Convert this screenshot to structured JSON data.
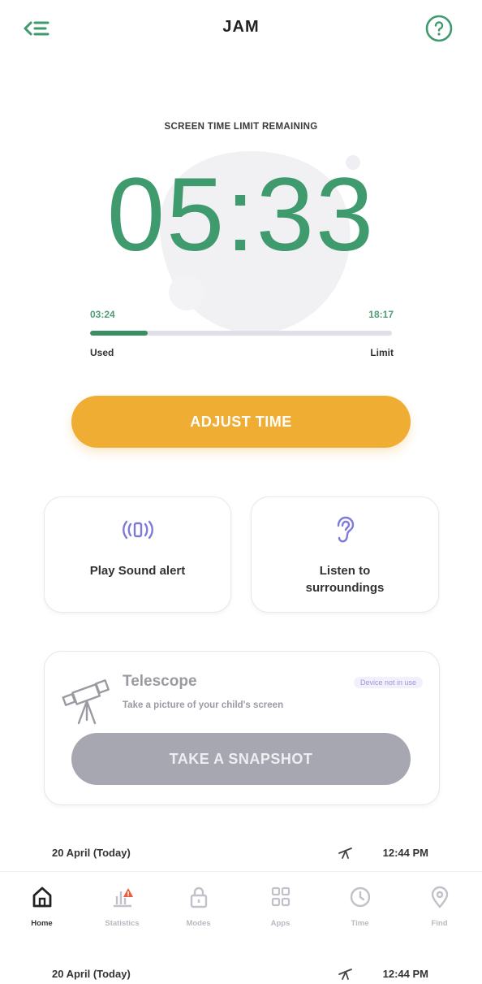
{
  "header": {
    "title": "JAM",
    "menu_icon": "menu-back-icon",
    "help_icon": "help-icon"
  },
  "timer": {
    "label": "SCREEN TIME LIMIT REMAINING",
    "remaining": "05:33",
    "used_time": "03:24",
    "limit_time": "18:17",
    "used_label": "Used",
    "limit_label": "Limit",
    "progress_fraction": 0.19
  },
  "actions": {
    "adjust_label": "ADJUST TIME",
    "play_sound_label": "Play Sound alert",
    "listen_label": "Listen to surroundings"
  },
  "telescope": {
    "title": "Telescope",
    "subtitle": "Take a picture of your child's screen",
    "badge": "Device not in use",
    "button_label": "TAKE A SNAPSHOT"
  },
  "activity": [
    {
      "date": "20 April (Today)",
      "time": "12:44 PM"
    },
    {
      "date": "20 April (Today)",
      "time": "12:44 PM"
    }
  ],
  "tabs": [
    {
      "label": "Home",
      "icon": "home-icon"
    },
    {
      "label": "Statistics",
      "icon": "statistics-icon"
    },
    {
      "label": "Modes",
      "icon": "lock-icon"
    },
    {
      "label": "Apps",
      "icon": "apps-grid-icon"
    },
    {
      "label": "Time",
      "icon": "clock-icon"
    },
    {
      "label": "Find",
      "icon": "location-pin-icon"
    }
  ],
  "colors": {
    "accent_green": "#3f9a6e",
    "adjust_orange": "#f0ad33",
    "disabled_grey": "#a6a7b1",
    "icon_purple": "#7d7adb"
  }
}
